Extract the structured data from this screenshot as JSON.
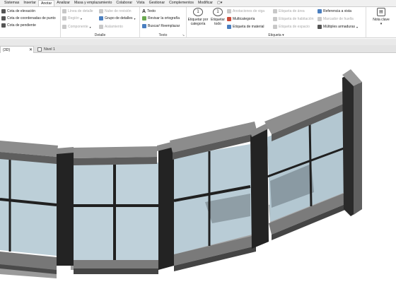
{
  "ribbon": {
    "tabs": [
      {
        "label": "Sistemas",
        "active": false
      },
      {
        "label": "Insertar",
        "active": false
      },
      {
        "label": "Anotar",
        "active": true
      },
      {
        "label": "Analizar",
        "active": false
      },
      {
        "label": "Masa y emplazamiento",
        "active": false
      },
      {
        "label": "Colaborar",
        "active": false
      },
      {
        "label": "Vista",
        "active": false
      },
      {
        "label": "Gestionar",
        "active": false
      },
      {
        "label": "Complementos",
        "active": false
      },
      {
        "label": "Modificar",
        "active": false
      },
      {
        "label": "▢▾",
        "active": false
      }
    ],
    "cotas": {
      "elevacion": "Cota de elevación",
      "coordenadas": "Cota de coordenadas de punto",
      "pendiente": "Cota de pendiente"
    },
    "detalle": {
      "title": "Detalle",
      "linea": "Línea de detalle",
      "region": "Región",
      "componente": "Componente",
      "nube": "Nube de revisión",
      "grupo": "Grupo de detalles",
      "aislamiento": "Aislamiento"
    },
    "texto": {
      "title": "Texto",
      "texto": "Texto",
      "ortografia": "Revisar la ortografía",
      "buscar": "Buscar/ Reemplazar"
    },
    "etiqueta": {
      "title": "Etiqueta",
      "por_categoria": "Etiquetar por categoría",
      "todo": "Etiquetar todo",
      "anotaciones": "Anotaciones de viga",
      "multicategoria": "Multicategoría",
      "material": "Etiqueta de material",
      "area": "Etiqueta de área",
      "habitacion": "Etiqueta de habitación",
      "espacio": "Etiqueta de espacio",
      "referencia": "Referencia a vista",
      "marcador": "Marcador de huella",
      "multiples": "Múltiples armaduras"
    },
    "nota": {
      "label": "Nota clave"
    }
  },
  "views": {
    "tab_3d": "{3D}",
    "close": "✕",
    "tab_level": "Nivel 1"
  },
  "colors": {
    "glass": "#b9cdd6",
    "frame": "#2b2b2b",
    "cap": "#7d7d7d",
    "shadow": "#8f8f8f"
  }
}
